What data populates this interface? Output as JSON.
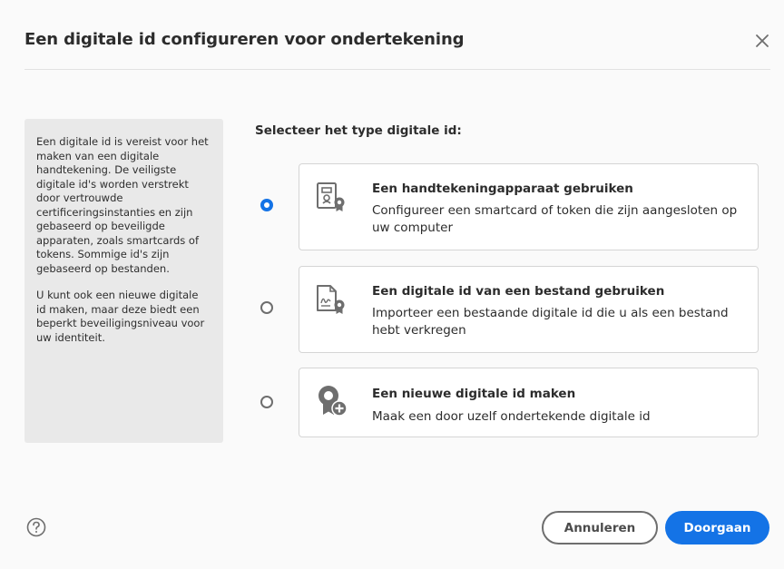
{
  "dialog": {
    "title": "Een digitale id configureren voor ondertekening",
    "close_icon": "close-icon"
  },
  "info": {
    "paragraph1": "Een digitale id is vereist voor het maken van een digitale handtekening. De veiligste digitale id's worden verstrekt door vertrouwde certificeringsinstanties en zijn gebaseerd op beveiligde apparaten, zoals smartcards of tokens. Sommige id's zijn gebaseerd op bestanden.",
    "paragraph2": "U kunt ook een nieuwe digitale id maken, maar deze biedt een beperkt beveiligingsniveau voor uw identiteit."
  },
  "prompt": "Selecteer het type digitale id:",
  "options": [
    {
      "title": "Een handtekeningapparaat gebruiken",
      "description": "Configureer een smartcard of token die zijn aangesloten op uw computer",
      "icon": "signing-device-icon",
      "selected": true
    },
    {
      "title": "Een digitale id van een bestand gebruiken",
      "description": "Importeer een bestaande digitale id die u als een bestand hebt verkregen",
      "icon": "certificate-file-icon",
      "selected": false
    },
    {
      "title": "Een nieuwe digitale id maken",
      "description": "Maak een door uzelf ondertekende digitale id",
      "icon": "new-certificate-icon",
      "selected": false
    }
  ],
  "footer": {
    "help_icon": "help-icon",
    "cancel_label": "Annuleren",
    "continue_label": "Doorgaan"
  },
  "colors": {
    "accent": "#1473e6",
    "info_panel": "#e9e9e9",
    "icon_gray": "#6e6e6e"
  }
}
